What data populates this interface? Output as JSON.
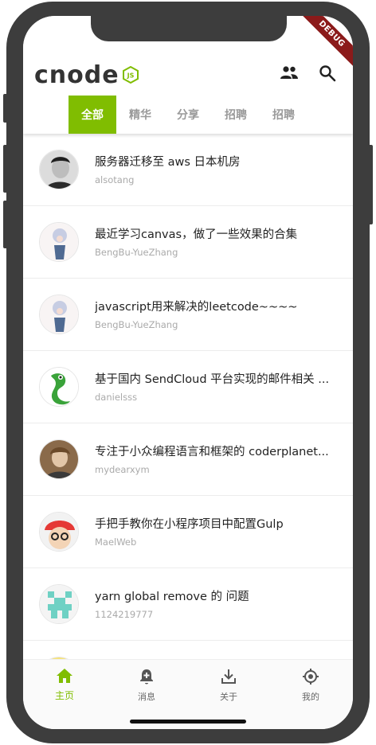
{
  "debug_banner": "DEBUG",
  "header": {
    "logo_text": "cnode",
    "logo_badge": "JS",
    "actions": [
      {
        "icon": "people-icon"
      },
      {
        "icon": "search-icon"
      }
    ]
  },
  "tabs": [
    {
      "label": "全部",
      "active": true
    },
    {
      "label": "精华",
      "active": false
    },
    {
      "label": "分享",
      "active": false
    },
    {
      "label": "招聘",
      "active": false
    },
    {
      "label": "招聘",
      "active": false
    }
  ],
  "topics": [
    {
      "title": "服务器迁移至 aws 日本机房",
      "author": "alsotang"
    },
    {
      "title": "最近学习canvas，做了一些效果的合集",
      "author": "BengBu-YueZhang"
    },
    {
      "title": "javascript用来解决的leetcode~~~~",
      "author": "BengBu-YueZhang"
    },
    {
      "title": "基于国内 SendCloud 平台实现的邮件相关 ...",
      "author": "danielsss"
    },
    {
      "title": "专注于小众编程语言和框架的  coderplanet...",
      "author": "mydearxym"
    },
    {
      "title": "手把手教你在小程序项目中配置Gulp",
      "author": "MaelWeb"
    },
    {
      "title": "yarn global remove 的 问题",
      "author": "1124219777"
    },
    {
      "title": "",
      "author": ""
    }
  ],
  "bottom_nav": [
    {
      "label": "主页",
      "icon": "home-icon",
      "active": true
    },
    {
      "label": "消息",
      "icon": "bell-icon",
      "active": false
    },
    {
      "label": "关于",
      "icon": "download-icon",
      "active": false
    },
    {
      "label": "我的",
      "icon": "location-icon",
      "active": false
    }
  ],
  "colors": {
    "accent": "#80bd01",
    "frame": "#3d3d3d",
    "debug": "#8b1a1a"
  }
}
